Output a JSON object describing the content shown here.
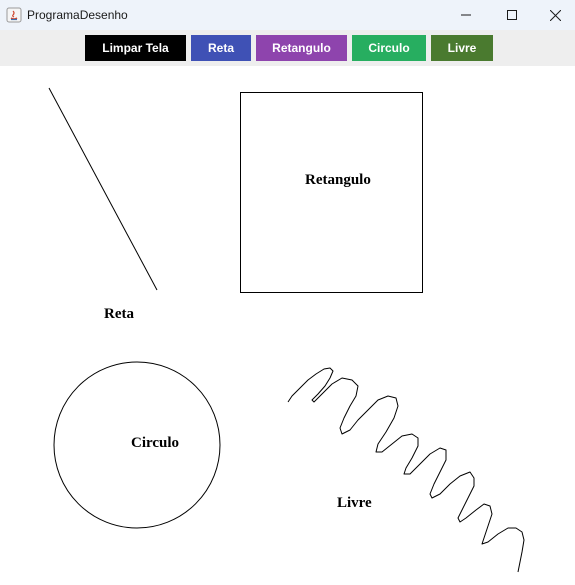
{
  "window": {
    "title": "ProgramaDesenho",
    "controls": {
      "minimize": "minimize-icon",
      "maximize": "maximize-icon",
      "close": "close-icon"
    }
  },
  "toolbar": {
    "buttons": [
      {
        "label": "Limpar Tela",
        "color": "#000000"
      },
      {
        "label": "Reta",
        "color": "#3f51b5"
      },
      {
        "label": "Retangulo",
        "color": "#8e44ad"
      },
      {
        "label": "Circulo",
        "color": "#27ae60"
      },
      {
        "label": "Livre",
        "color": "#4a7a2f"
      }
    ]
  },
  "canvas": {
    "shapes": [
      {
        "type": "line",
        "label": "Reta"
      },
      {
        "type": "rectangle",
        "label": "Retangulo"
      },
      {
        "type": "circle",
        "label": "Circulo"
      },
      {
        "type": "freehand",
        "label": "Livre"
      }
    ]
  }
}
